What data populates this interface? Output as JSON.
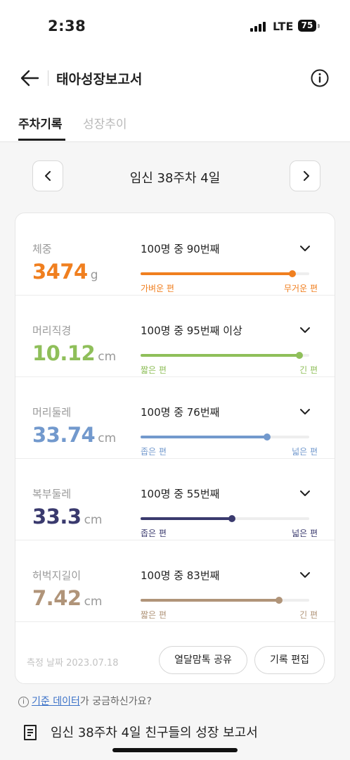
{
  "status_bar": {
    "time": "2:38",
    "network": "LTE",
    "battery": "75"
  },
  "header": {
    "title": "태아성장보고서",
    "back_icon": "arrow-left-icon",
    "info_icon": "info-circle-icon"
  },
  "tabs": [
    {
      "label": "주차기록",
      "active": true
    },
    {
      "label": "성장추이",
      "active": false
    }
  ],
  "week_nav": {
    "label": "임신 38주차 4일"
  },
  "measurements": [
    {
      "label": "체중",
      "value": "3474",
      "unit": "g",
      "rank": "100명 중 90번째",
      "percent": 0.9,
      "low_label": "가벼운 편",
      "high_label": "무거운 편",
      "color": "#f07f1f"
    },
    {
      "label": "머리직경",
      "value": "10.12",
      "unit": "cm",
      "rank": "100명 중 95번째 이상",
      "percent": 0.94,
      "low_label": "짧은 편",
      "high_label": "긴 편",
      "color": "#8fbf5a"
    },
    {
      "label": "머리둘레",
      "value": "33.74",
      "unit": "cm",
      "rank": "100명 중 76번째",
      "percent": 0.75,
      "low_label": "좁은 편",
      "high_label": "넓은 편",
      "color": "#7299cd"
    },
    {
      "label": "복부둘레",
      "value": "33.3",
      "unit": "cm",
      "rank": "100명 중 55번째",
      "percent": 0.54,
      "low_label": "좁은 편",
      "high_label": "넓은 편",
      "color": "#3a3a6e"
    },
    {
      "label": "허벅지길이",
      "value": "7.42",
      "unit": "cm",
      "rank": "100명 중 83번째",
      "percent": 0.82,
      "low_label": "짧은 편",
      "high_label": "긴 편",
      "color": "#b09479"
    }
  ],
  "footer": {
    "date": "측정 날짜 2023.07.18",
    "share_label": "열달맘톡 공유",
    "edit_label": "기록 편집"
  },
  "help": {
    "link": "기준 데이터",
    "suffix": "가 궁금하신가요?"
  },
  "report": {
    "label": "임신 38주차 4일 친구들의 성장 보고서"
  }
}
